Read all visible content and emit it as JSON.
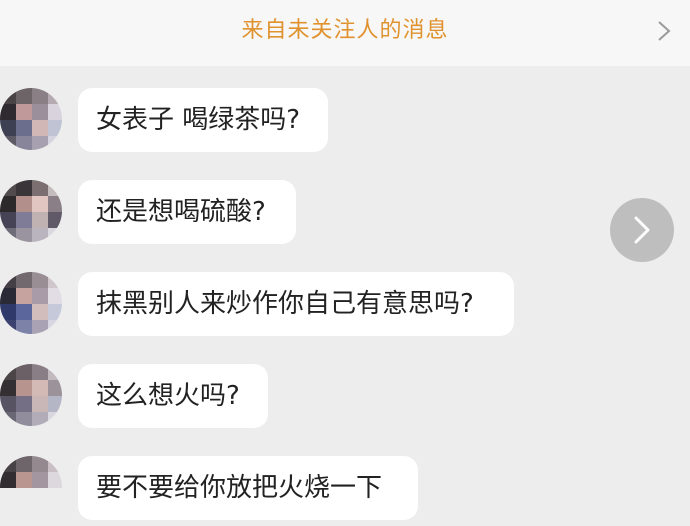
{
  "header": {
    "title": "来自未关注人的消息",
    "title_color": "#e0922f",
    "chevron_icon": "chevron-right-icon"
  },
  "messages": [
    {
      "text": "女表子 喝绿茶吗?"
    },
    {
      "text": "还是想喝硫酸?"
    },
    {
      "text": "抹黑别人来炒作你自己有意思吗?"
    },
    {
      "text": "这么想火吗?"
    },
    {
      "text": "要不要给你放把火烧一下"
    }
  ],
  "floating_button": {
    "icon": "chevron-right-icon"
  }
}
